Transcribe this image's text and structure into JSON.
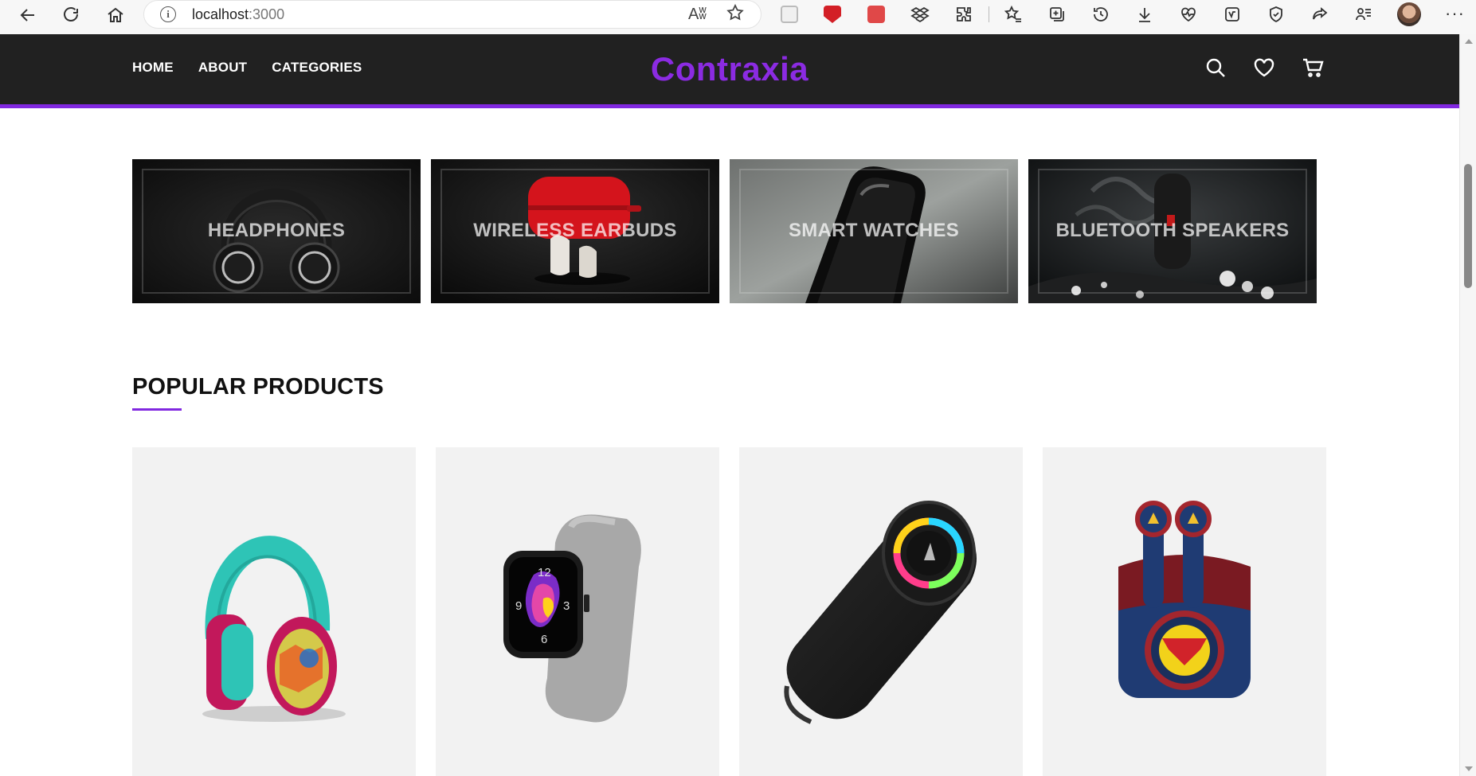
{
  "browser": {
    "url_host": "localhost",
    "url_port": ":3000",
    "read_aloud_label": "Aʬ"
  },
  "site": {
    "brand": "Contraxia",
    "accent_color": "#8128e0",
    "nav": [
      "HOME",
      "ABOUT",
      "CATEGORIES"
    ],
    "header_icons": [
      "search-icon",
      "heart-icon",
      "cart-icon"
    ]
  },
  "categories": [
    {
      "label": "HEADPHONES"
    },
    {
      "label": "WIRELESS EARBUDS"
    },
    {
      "label": "SMART WATCHES"
    },
    {
      "label": "BLUETOOTH SPEAKERS"
    }
  ],
  "popular": {
    "title": "POPULAR PRODUCTS"
  },
  "products": [
    {
      "image": "teal-headphones"
    },
    {
      "image": "grey-smartwatch"
    },
    {
      "image": "black-speaker"
    },
    {
      "image": "superman-earbuds"
    }
  ]
}
